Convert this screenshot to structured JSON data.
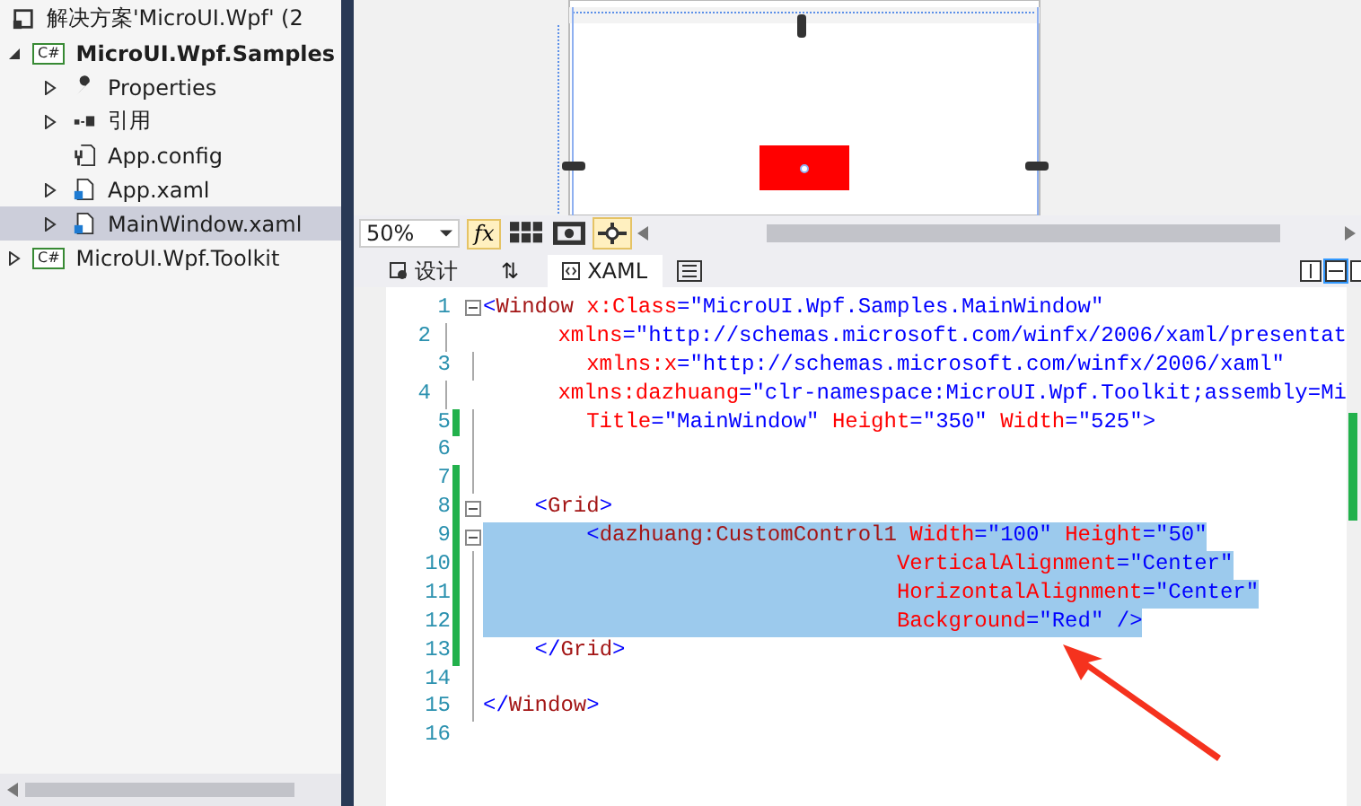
{
  "solution_explorer": {
    "solution": "解决方案'MicroUI.Wpf' (2",
    "projects": [
      {
        "label": "MicroUI.Wpf.Samples",
        "badge": "C#",
        "expanded": true,
        "bold": true,
        "children": [
          {
            "label": "Properties",
            "expandable": true,
            "selected": false
          },
          {
            "label": "引用",
            "expandable": true,
            "selected": false
          },
          {
            "label": "App.config",
            "expandable": false,
            "selected": false
          },
          {
            "label": "App.xaml",
            "expandable": true,
            "selected": false
          },
          {
            "label": "MainWindow.xaml",
            "expandable": true,
            "selected": true
          }
        ]
      },
      {
        "label": "MicroUI.Wpf.Toolkit",
        "badge": "C#",
        "expanded": false,
        "bold": false
      }
    ]
  },
  "designer_toolbar": {
    "zoom": "50%",
    "fx": "fx"
  },
  "view_tabs": [
    {
      "label": "设计",
      "selected": false
    },
    {
      "label": "⇅",
      "selected": false
    },
    {
      "label": "XAML",
      "selected": true
    }
  ],
  "editor": {
    "lines": [
      {
        "number": "1",
        "collapsible": true,
        "changed": false,
        "selected": false,
        "tokens": [
          {
            "kind": "punct",
            "text": "<"
          },
          {
            "kind": "tag",
            "text": "Window"
          },
          {
            "kind": "attr",
            "text": " x:Class"
          },
          {
            "kind": "punct",
            "text": "="
          },
          {
            "kind": "value",
            "text": "\"MicroUI.Wpf.Samples.MainWindow\""
          }
        ]
      },
      {
        "number": "2",
        "collapsible": false,
        "changed": false,
        "selected": false,
        "tokens": [
          {
            "kind": "attr",
            "text": "        xmlns"
          },
          {
            "kind": "punct",
            "text": "="
          },
          {
            "kind": "value",
            "text": "\"http://schemas.microsoft.com/winfx/2006/xaml/presentat"
          }
        ]
      },
      {
        "number": "3",
        "collapsible": false,
        "changed": false,
        "selected": false,
        "tokens": [
          {
            "kind": "attr",
            "text": "        xmlns:x"
          },
          {
            "kind": "punct",
            "text": "="
          },
          {
            "kind": "value",
            "text": "\"http://schemas.microsoft.com/winfx/2006/xaml\""
          }
        ]
      },
      {
        "number": "4",
        "collapsible": false,
        "changed": false,
        "selected": false,
        "tokens": [
          {
            "kind": "attr",
            "text": "        xmlns:dazhuang"
          },
          {
            "kind": "punct",
            "text": "="
          },
          {
            "kind": "value",
            "text": "\"clr-namespace:MicroUI.Wpf.Toolkit;assembly=Mi"
          }
        ]
      },
      {
        "number": "5",
        "collapsible": false,
        "changed": true,
        "selected": false,
        "tokens": [
          {
            "kind": "attr",
            "text": "        Title"
          },
          {
            "kind": "punct",
            "text": "="
          },
          {
            "kind": "value",
            "text": "\"MainWindow\""
          },
          {
            "kind": "attr",
            "text": " Height"
          },
          {
            "kind": "punct",
            "text": "="
          },
          {
            "kind": "value",
            "text": "\"350\""
          },
          {
            "kind": "attr",
            "text": " Width"
          },
          {
            "kind": "punct",
            "text": "="
          },
          {
            "kind": "value",
            "text": "\"525\""
          },
          {
            "kind": "punct",
            "text": ">"
          }
        ]
      },
      {
        "number": "6",
        "collapsible": false,
        "changed": false,
        "selected": false
      },
      {
        "number": "7",
        "collapsible": false,
        "changed": true,
        "selected": false
      },
      {
        "number": "8",
        "collapsible": true,
        "changed": true,
        "selected": false,
        "tokens": [
          {
            "kind": "punct",
            "text": "    <"
          },
          {
            "kind": "tag",
            "text": "Grid"
          },
          {
            "kind": "punct",
            "text": ">"
          }
        ]
      },
      {
        "number": "9",
        "collapsible": true,
        "changed": true,
        "selected": true,
        "tokens": [
          {
            "kind": "punct",
            "text": "        <"
          },
          {
            "kind": "tag",
            "text": "dazhuang:CustomControl1"
          },
          {
            "kind": "attr",
            "text": " Width"
          },
          {
            "kind": "punct",
            "text": "="
          },
          {
            "kind": "value",
            "text": "\"100\""
          },
          {
            "kind": "attr",
            "text": " Height"
          },
          {
            "kind": "punct",
            "text": "="
          },
          {
            "kind": "value",
            "text": "\"50\""
          }
        ]
      },
      {
        "number": "10",
        "collapsible": false,
        "changed": true,
        "selected": true,
        "tokens": [
          {
            "kind": "attr",
            "text": "                                VerticalAlignment"
          },
          {
            "kind": "punct",
            "text": "="
          },
          {
            "kind": "value",
            "text": "\"Center\""
          }
        ]
      },
      {
        "number": "11",
        "collapsible": false,
        "changed": true,
        "selected": true,
        "tokens": [
          {
            "kind": "attr",
            "text": "                                HorizontalAlignment"
          },
          {
            "kind": "punct",
            "text": "="
          },
          {
            "kind": "value",
            "text": "\"Center\""
          }
        ]
      },
      {
        "number": "12",
        "collapsible": false,
        "changed": true,
        "selected": true,
        "tokens": [
          {
            "kind": "attr",
            "text": "                                Background"
          },
          {
            "kind": "punct",
            "text": "="
          },
          {
            "kind": "value",
            "text": "\"Red\""
          },
          {
            "kind": "punct",
            "text": " />"
          }
        ]
      },
      {
        "number": "13",
        "collapsible": false,
        "changed": true,
        "selected": false,
        "tokens": [
          {
            "kind": "punct",
            "text": "    </"
          },
          {
            "kind": "tag",
            "text": "Grid"
          },
          {
            "kind": "punct",
            "text": ">"
          }
        ]
      },
      {
        "number": "14",
        "collapsible": false,
        "changed": false,
        "selected": false
      },
      {
        "number": "15",
        "collapsible": false,
        "changed": false,
        "selected": false,
        "tokens": [
          {
            "kind": "punct",
            "text": "</"
          },
          {
            "kind": "tag",
            "text": "Window"
          },
          {
            "kind": "punct",
            "text": ">"
          }
        ]
      },
      {
        "number": "16",
        "collapsible": false,
        "changed": false,
        "selected": false
      }
    ]
  }
}
